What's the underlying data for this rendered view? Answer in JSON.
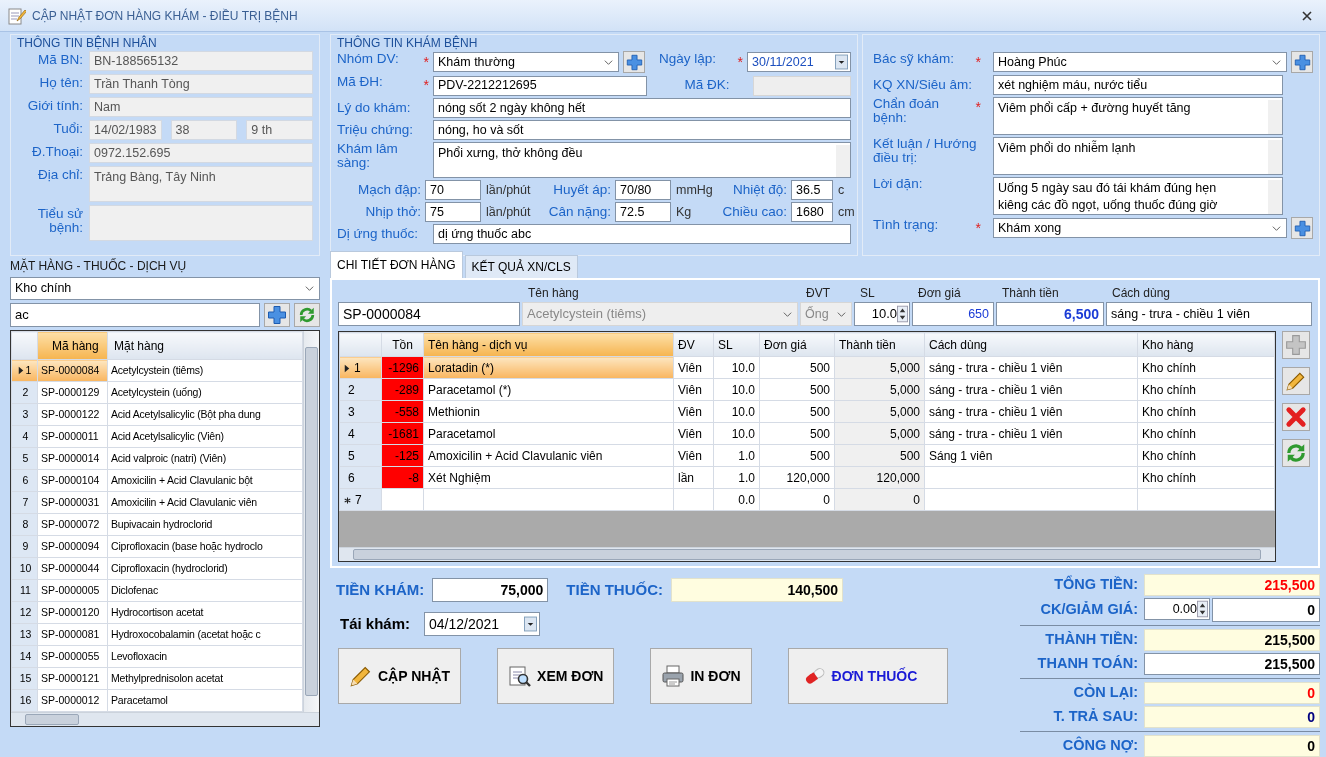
{
  "window": {
    "title": "CẬP NHẬT ĐƠN HÀNG KHÁM - ĐIỀU TRỊ BỆNH"
  },
  "patient": {
    "title": "THÔNG TIN BỆNH NHÂN",
    "fields": [
      {
        "label": "Mã BN:",
        "values": [
          "BN-188565132"
        ]
      },
      {
        "label": "Họ tên:",
        "values": [
          "Trần Thanh Tòng"
        ]
      },
      {
        "label": "Giới tính:",
        "values": [
          "Nam"
        ]
      },
      {
        "label": "Tuổi:",
        "values": [
          "14/02/1983",
          "38",
          "9 th"
        ]
      },
      {
        "label": "Đ.Thoại:",
        "values": [
          "0972.152.695"
        ]
      },
      {
        "label": "Địa chỉ:",
        "values": [
          "Trảng Bàng, Tây Ninh"
        ],
        "kind": "multiline"
      },
      {
        "label": "Tiểu sử bệnh:",
        "kind": "multiline"
      }
    ]
  },
  "exam": {
    "title": "THÔNG TIN KHÁM BỆNH",
    "service_group": {
      "label": "Nhóm DV:",
      "required_mark": "*",
      "value": "Khám thường"
    },
    "created_date": {
      "label": "Ngày lập:",
      "required_mark": "*",
      "value": "30/11/2021"
    },
    "order_code": {
      "label": "Mã ĐH:",
      "required_mark": "*",
      "value": "PDV-2212212695"
    },
    "reg_code": {
      "label": "Mã ĐK:"
    },
    "reason": {
      "label": "Lý do khám:",
      "value": "nóng sốt 2 ngày không hết"
    },
    "symptoms": {
      "label": "Triệu chứng:",
      "value": "nóng, ho và sốt"
    },
    "clinical": {
      "label": "Khám lâm sàng:",
      "value": "Phổi xưng, thở không đều"
    },
    "vitals": [
      {
        "label": "Mạch đập:",
        "value": "70",
        "unit": "lần/phút"
      },
      {
        "label": "Huyết áp:",
        "value": "70/80",
        "unit": "mmHg"
      },
      {
        "label": "Nhiệt độ:",
        "value": "36.5",
        "unit": "c"
      },
      {
        "label": "Nhịp thở:",
        "value": "75",
        "unit": "lần/phút"
      },
      {
        "label": "Cân nặng:",
        "value": "72.5",
        "unit": "Kg"
      },
      {
        "label": "Chiều cao:",
        "value": "1680",
        "unit": "cm"
      }
    ],
    "allergy": {
      "label": "Dị ứng thuốc:",
      "value": "dị ứng thuốc abc"
    }
  },
  "diagnosis": {
    "fields": [
      {
        "label": "Bác sỹ khám:",
        "required_mark": "*",
        "value": "Hoàng Phúc",
        "kind": "select_add"
      },
      {
        "label": "KQ XN/Siêu âm:",
        "value": "xét nghiệm máu, nước tiểu",
        "kind": "text"
      },
      {
        "label": "Chẩn đoán bệnh:",
        "required_mark": "*",
        "value": "Viêm phổi cấp + đường huyết tăng",
        "kind": "textarea"
      },
      {
        "label": "Kết luận / Hướng điều trị:",
        "value": "Viêm phổi do nhiễm lạnh",
        "kind": "textarea"
      },
      {
        "label": "Lời dặn:",
        "value": "Uống 5 ngày sau đó tái khám đúng hẹn\nkiêng các đồ ngọt, uống thuốc đúng giờ",
        "kind": "textarea"
      },
      {
        "label": "Tình trạng:",
        "required_mark": "*",
        "value": "Khám xong",
        "kind": "select_add"
      }
    ]
  },
  "items": {
    "title": "MẶT HÀNG - THUỐC - DỊCH VỤ",
    "warehouse": "Kho chính",
    "search": "ac",
    "columns": [
      {
        "label": "Mã hàng",
        "sorted": true
      },
      {
        "label": "Mặt hàng",
        "sorted": false
      }
    ],
    "rows": [
      {
        "no": "1",
        "code": "SP-0000084",
        "name": "Acetylcystein (tiêms)",
        "selected": true
      },
      {
        "no": "2",
        "code": "SP-0000129",
        "name": "Acetylcystein (uống)",
        "selected": false
      },
      {
        "no": "3",
        "code": "SP-0000122",
        "name": "Acid Acetylsalicylic (Bột pha dung",
        "selected": false
      },
      {
        "no": "4",
        "code": "SP-0000011",
        "name": "Acid Acetylsalicylic (Viên)",
        "selected": false
      },
      {
        "no": "5",
        "code": "SP-0000014",
        "name": "Acid valproic (natri) (Viên)",
        "selected": false
      },
      {
        "no": "6",
        "code": "SP-0000104",
        "name": "Amoxicilin + Acid Clavulanic bột",
        "selected": false
      },
      {
        "no": "7",
        "code": "SP-0000031",
        "name": "Amoxicilin + Acid Clavulanic viên",
        "selected": false
      },
      {
        "no": "8",
        "code": "SP-0000072",
        "name": "Bupivacain hydroclorid",
        "selected": false
      },
      {
        "no": "9",
        "code": "SP-0000094",
        "name": "Ciprofloxacin (base hoặc hydroclo",
        "selected": false
      },
      {
        "no": "10",
        "code": "SP-0000044",
        "name": "Ciprofloxacin (hydroclorid)",
        "selected": false
      },
      {
        "no": "11",
        "code": "SP-0000005",
        "name": "Diclofenac",
        "selected": false
      },
      {
        "no": "12",
        "code": "SP-0000120",
        "name": "Hydrocortison acetat",
        "selected": false
      },
      {
        "no": "13",
        "code": "SP-0000081",
        "name": "Hydroxocobalamin (acetat hoặc c",
        "selected": false
      },
      {
        "no": "14",
        "code": "SP-0000055",
        "name": "Levofloxacin",
        "selected": false
      },
      {
        "no": "15",
        "code": "SP-0000121",
        "name": "Methylprednisolon acetat",
        "selected": false
      },
      {
        "no": "16",
        "code": "SP-0000012",
        "name": "Paracetamol",
        "selected": false
      }
    ]
  },
  "tabs": [
    {
      "label": "CHI TIẾT ĐƠN HÀNG",
      "selected": true
    },
    {
      "label": "KẾT QUẢ XN/CLS",
      "selected": false
    }
  ],
  "entry": {
    "code": "SP-0000084",
    "name_label": "Tên hàng",
    "name": "Acetylcystein (tiêms)",
    "unit_label": "ĐVT",
    "unit": "Ống",
    "qty_label": "SL",
    "qty": "10.0",
    "price_label": "Đơn giá",
    "price": "650",
    "total_label": "Thành tiền",
    "total": "6,500",
    "usage_label": "Cách dùng",
    "usage": "sáng - trưa - chiều 1 viên"
  },
  "order": {
    "columns": [
      {
        "label": "Tồn",
        "sorted": false
      },
      {
        "label": "Tên hàng - dịch vụ",
        "sorted": true
      },
      {
        "label": "ĐV",
        "sorted": false
      },
      {
        "label": "SL",
        "sorted": false
      },
      {
        "label": "Đơn giá",
        "sorted": false
      },
      {
        "label": "Thành tiền",
        "sorted": false
      },
      {
        "label": "Cách dùng",
        "sorted": false
      },
      {
        "label": "Kho hàng",
        "sorted": false
      }
    ],
    "rows": [
      {
        "kind": "item",
        "no": "1",
        "stock": "-1296",
        "stock_alert": true,
        "name": "Loratadin (*)",
        "unit": "Viên",
        "qty": "10.0",
        "price": "500",
        "total": "5,000",
        "usage": "sáng - trưa - chiều 1 viên",
        "warehouse": "Kho chính",
        "selected": true
      },
      {
        "kind": "item",
        "no": "2",
        "stock": "-289",
        "stock_alert": true,
        "name": "Paracetamol (*)",
        "unit": "Viên",
        "qty": "10.0",
        "price": "500",
        "total": "5,000",
        "usage": "sáng - trưa - chiều 1 viên",
        "warehouse": "Kho chính",
        "selected": false
      },
      {
        "kind": "item",
        "no": "3",
        "stock": "-558",
        "stock_alert": true,
        "name": "Methionin",
        "unit": "Viên",
        "qty": "10.0",
        "price": "500",
        "total": "5,000",
        "usage": "sáng - trưa - chiều 1 viên",
        "warehouse": "Kho chính",
        "selected": false
      },
      {
        "kind": "item",
        "no": "4",
        "stock": "-1681",
        "stock_alert": true,
        "name": "Paracetamol",
        "unit": "Viên",
        "qty": "10.0",
        "price": "500",
        "total": "5,000",
        "usage": "sáng - trưa - chiều 1 viên",
        "warehouse": "Kho chính",
        "selected": false
      },
      {
        "kind": "item",
        "no": "5",
        "stock": "-125",
        "stock_alert": true,
        "name": "Amoxicilin + Acid Clavulanic viên",
        "unit": "Viên",
        "qty": "1.0",
        "price": "500",
        "total": "500",
        "usage": "Sáng 1 viên",
        "warehouse": "Kho chính",
        "selected": false
      },
      {
        "kind": "item",
        "no": "6",
        "stock": "-8",
        "stock_alert": true,
        "name": "Xét Nghiệm",
        "unit": "lần",
        "qty": "1.0",
        "price": "120,000",
        "total": "120,000",
        "warehouse": "Kho chính",
        "selected": false
      },
      {
        "kind": "new",
        "no": "7",
        "qty": "0.0",
        "price": "0",
        "total": "0",
        "selected": false
      }
    ]
  },
  "grid_tools": [
    {
      "kind": "add",
      "disabled": true
    },
    {
      "kind": "edit",
      "disabled": false
    },
    {
      "kind": "delete",
      "disabled": false
    },
    {
      "kind": "refresh",
      "disabled": false
    }
  ],
  "fees": [
    {
      "label": "TIỀN KHÁM:",
      "value": "75,000",
      "kind": "input"
    },
    {
      "label": "TIỀN THUỐC:",
      "value": "140,500",
      "kind": "readonly"
    }
  ],
  "revisit": {
    "label": "Tái khám:",
    "value": "04/12/2021"
  },
  "actions": [
    {
      "label": "CẬP NHẬT",
      "kind": "update"
    },
    {
      "label": "XEM ĐƠN",
      "kind": "preview"
    },
    {
      "label": "IN ĐƠN",
      "kind": "print"
    },
    {
      "label": "ĐƠN THUỐC",
      "kind": "prescription"
    }
  ],
  "totals": [
    [
      {
        "label": "TỔNG TIỀN:",
        "value": "215,500",
        "kind": "readonly",
        "color": "#ff0000"
      },
      {
        "label": "CK/GIẢM GIÁ:",
        "percent": "0.00",
        "value": "0",
        "kind": "discount",
        "color": "#000000"
      }
    ],
    [
      {
        "label": "THÀNH TIỀN:",
        "value": "215,500",
        "kind": "readonly",
        "color": "#000000"
      },
      {
        "label": "THANH TOÁN:",
        "value": "215,500",
        "kind": "input",
        "color": "#000000"
      }
    ],
    [
      {
        "label": "CÒN LẠI:",
        "value": "0",
        "kind": "readonly",
        "color": "#ff0000"
      },
      {
        "label": "T. TRẢ SAU:",
        "value": "0",
        "kind": "readonly",
        "color": "#000080"
      }
    ],
    [
      {
        "label": "CÔNG NỢ:",
        "value": "0",
        "kind": "readonly",
        "color": "#000000"
      }
    ]
  ]
}
